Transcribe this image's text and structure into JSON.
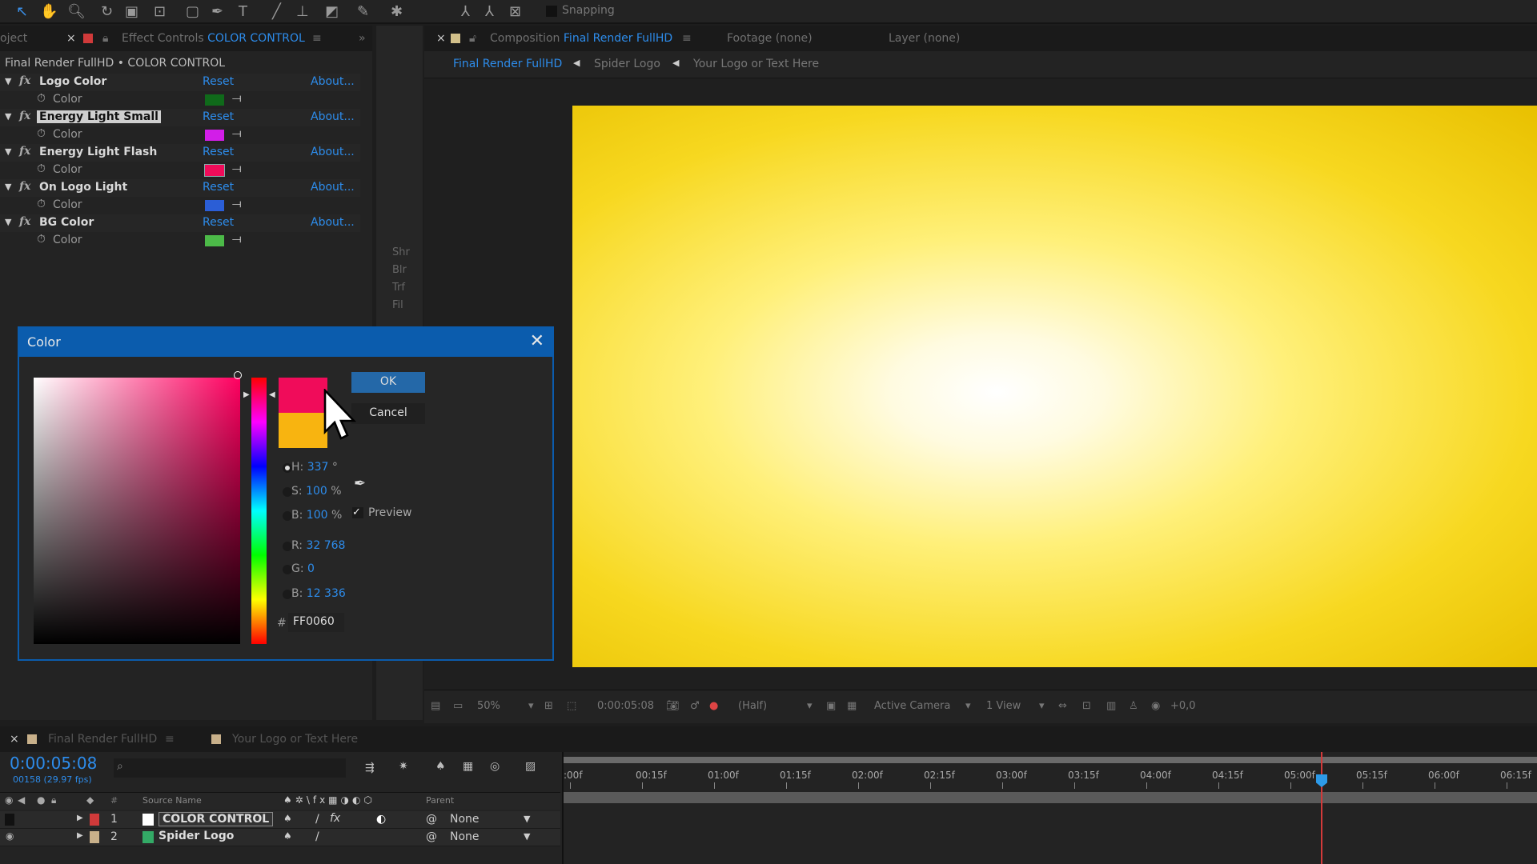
{
  "toolbar": {
    "snapping": "Snapping"
  },
  "left_tabs": {
    "project": "oject",
    "effect_controls_prefix": "Effect Controls",
    "effect_controls_name": "COLOR CONTROL"
  },
  "comp_tabs": {
    "composition_prefix": "Composition",
    "composition_name": "Final Render FullHD",
    "footage": "Footage",
    "footage_val": "(none)",
    "layer": "Layer",
    "layer_val": "(none)"
  },
  "breadcrumbs": [
    "Final Render FullHD",
    "Spider Logo",
    "Your Logo or Text Here"
  ],
  "effect_panel": {
    "title": "Final Render FullHD • COLOR CONTROL",
    "reset": "Reset",
    "about": "About...",
    "param": "Color",
    "effects": [
      {
        "name": "Logo Color",
        "color": "#0f6a1a"
      },
      {
        "name": "Energy Light Small",
        "color": "#d21ee8"
      },
      {
        "name": "Energy Light Flash",
        "color": "#f00c5a"
      },
      {
        "name": "On Logo Light",
        "color": "#2b5ed6"
      },
      {
        "name": "BG Color",
        "color": "#4cba48"
      }
    ]
  },
  "side_strip": [
    "Shr",
    "Blr",
    "Trf",
    "Fil"
  ],
  "color_dialog": {
    "title": "Color",
    "ok": "OK",
    "cancel": "Cancel",
    "preview": "Preview",
    "preview_checked": true,
    "new_color": "#f00c5a",
    "old_color": "#f8b410",
    "h_label": "H:",
    "h": "337",
    "h_unit": "°",
    "s_label": "S:",
    "s": "100",
    "s_unit": "%",
    "b_label": "B:",
    "b": "100",
    "b_unit": "%",
    "r_label": "R:",
    "r": "32 768",
    "g_label": "G:",
    "g": "0",
    "bl_label": "B:",
    "bl": "12 336",
    "hex_label": "#",
    "hex": "FF0060"
  },
  "viewer_bar": {
    "zoom": "50%",
    "timecode": "0:00:05:08",
    "resolution": "(Half)",
    "camera": "Active Camera",
    "views": "1 View",
    "exposure": "+0,0"
  },
  "timeline": {
    "tab1": "Final Render FullHD",
    "tab2": "Your Logo or Text Here",
    "timecode": "0:00:05:08",
    "frames": "00158 (29.97 fps)",
    "col_num": "#",
    "col_source": "Source Name",
    "col_parent": "Parent",
    "ticks": [
      ":00f",
      "00:15f",
      "01:00f",
      "01:15f",
      "02:00f",
      "02:15f",
      "03:00f",
      "03:15f",
      "04:00f",
      "04:15f",
      "05:00f",
      "05:15f",
      "06:00f",
      "06:15f"
    ],
    "layers": [
      {
        "num": "1",
        "name": "COLOR CONTROL",
        "parent": "None",
        "label_color": "#d03a3a",
        "bar_color": "#b8343c"
      },
      {
        "num": "2",
        "name": "Spider Logo",
        "parent": "None",
        "label_color": "#c8b08a",
        "bar_color": "#7d6a5a"
      }
    ]
  }
}
